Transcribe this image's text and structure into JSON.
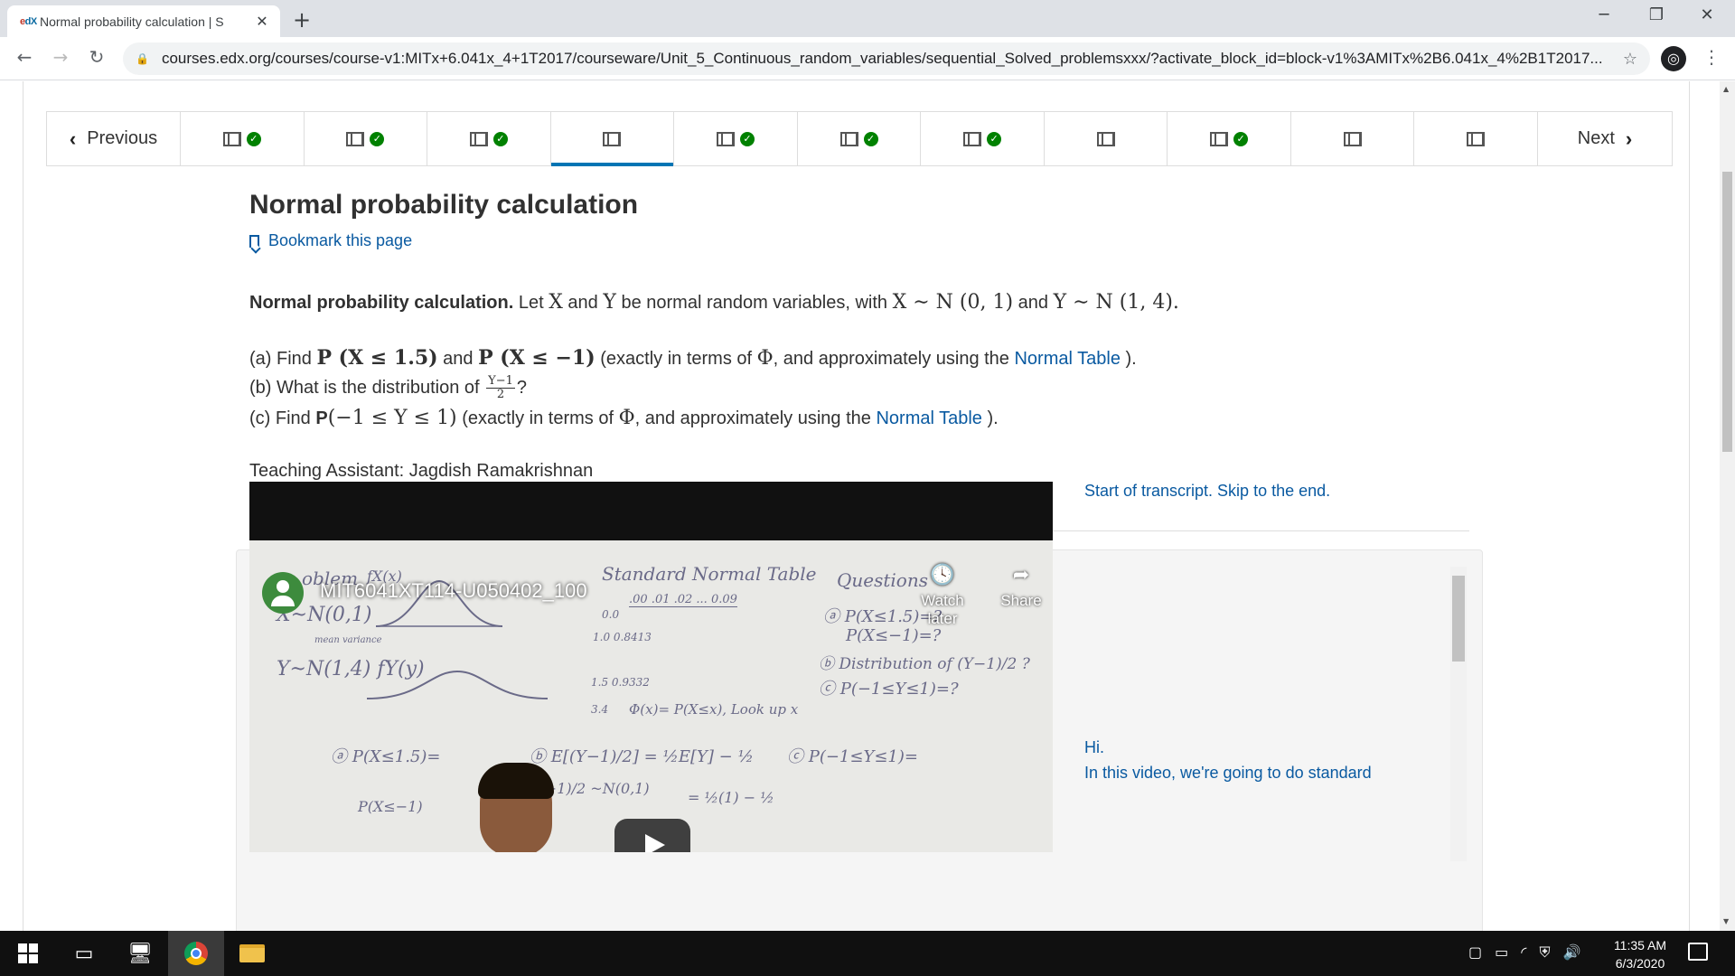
{
  "browser": {
    "tab_title": "Normal probability calculation | S",
    "favicon_text": "edX",
    "url": "courses.edx.org/courses/course-v1:MITx+6.041x_4+1T2017/courseware/Unit_5_Continuous_random_variables/sequential_Solved_problemsxxx/?activate_block_id=block-v1%3AMITx%2B6.041x_4%2B1T2017...",
    "profile_icon": "profile-icon"
  },
  "sequence_nav": {
    "previous_label": "Previous",
    "next_label": "Next",
    "items": [
      {
        "type": "video",
        "completed": true
      },
      {
        "type": "video",
        "completed": true
      },
      {
        "type": "video",
        "completed": true
      },
      {
        "type": "video",
        "completed": false,
        "active": true
      },
      {
        "type": "video",
        "completed": true
      },
      {
        "type": "video",
        "completed": true
      },
      {
        "type": "video",
        "completed": true
      },
      {
        "type": "video",
        "completed": false
      },
      {
        "type": "video",
        "completed": true
      },
      {
        "type": "video",
        "completed": false
      },
      {
        "type": "video",
        "completed": false
      }
    ]
  },
  "unit": {
    "title": "Normal probability calculation",
    "bookmark_label": "Bookmark this page"
  },
  "problem": {
    "intro_bold": "Normal probability calculation.",
    "intro_text_1": " Let ",
    "var_x": "X",
    "and": " and ",
    "var_y": "Y",
    "intro_text_2": " be normal random variables, with ",
    "dist_x": "X ∼ N (0, 1)",
    "dist_y": "Y ∼ N (1, 4).",
    "a_prefix": "(a) Find ",
    "a_math_1": "P (X ≤ 1.5)",
    "a_math_2": "P (X ≤ −1)",
    "a_suffix_1": " (exactly in terms of ",
    "phi": "Φ",
    "a_suffix_2": ", and approximately using the ",
    "normal_table": "Normal Table",
    "close_paren": " ).",
    "b_prefix": "(b) What is the distribution of ",
    "b_frac_num": "Y−1",
    "b_frac_den": "2",
    "b_suffix": "?",
    "c_prefix": "(c) Find ",
    "c_bold_p": "P",
    "c_math": "(−1 ≤ Y ≤ 1)",
    "ta_label": "Teaching Assistant: Jagdish Ramakrishnan"
  },
  "video": {
    "title": "MIT6041XT114-U050402_100",
    "watch_later": "Watch later",
    "share": "Share",
    "board_text": {
      "problem": "oblem",
      "std_table": "Standard Normal Table",
      "questions": "Questions",
      "xn": "X~N(0,1)",
      "mean_var": "mean  variance",
      "yn": "Y~N(1,4)  fY(y)",
      "fx": "fX(x)",
      "table_head": ".00  .01  .02  ...  0.09",
      "row0": "0.0",
      "row1": "1.0  0.8413",
      "row15": "1.5  0.9332",
      "row34": "3.4",
      "phi_def": "Φ(x)= P(X≤x), Look up x",
      "qa1": "ⓐ P(X≤1.5)=?",
      "qa2": "P(X≤−1)=?",
      "qb": "ⓑ Distribution of (Y−1)/2 ?",
      "qc": "ⓒ P(−1≤Y≤1)=?",
      "ans_a": "ⓐ P(X≤1.5)=",
      "ans_b": "ⓑ E[(Y−1)/2] = ½E[Y] − ½",
      "ans_b2": "(Y−1)/2 ~N(0,1)",
      "ans_b3": "= ½(1) − ½",
      "ans_c": "ⓒ P(−1≤Y≤1)=",
      "ans_a2": "P(X≤−1)"
    }
  },
  "transcript": {
    "start": "Start of transcript. Skip to the end.",
    "line1": "Hi.",
    "line2": "In this video, we're going to do standard"
  },
  "taskbar": {
    "time": "11:35 AM",
    "date": "6/3/2020"
  }
}
